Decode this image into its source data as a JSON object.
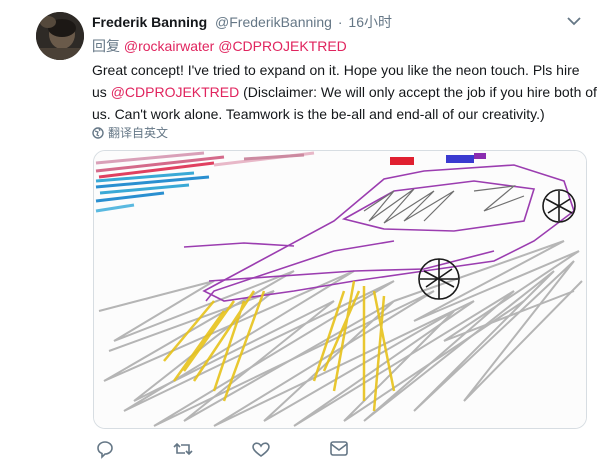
{
  "tweet": {
    "display_name": "Frederik Banning",
    "handle": "@FrederikBanning",
    "separator": "·",
    "time": "16小时",
    "reply_prefix": "回复",
    "reply_to": [
      "@rockairwater",
      "@CDPROJEKTRED"
    ],
    "body_1": "Great concept! I've tried to expand on it. Hope you like the neon touch. Pls hire us ",
    "body_mention": "@CDPROJEKTRED",
    "body_2": " (Disclaimer: We will only accept the job if you hire both of us. Can't work alone. Teamwork is the be-all and end-all of our creativity.)",
    "translate_label": "翻译自英文"
  },
  "icons": {
    "menu": "chevron-down-icon",
    "translate": "globe-icon",
    "actions": [
      "reply-icon",
      "retweet-icon",
      "like-icon",
      "share-icon"
    ]
  },
  "colors": {
    "mention": "#e0245e",
    "muted": "#657786",
    "text": "#14171a"
  }
}
